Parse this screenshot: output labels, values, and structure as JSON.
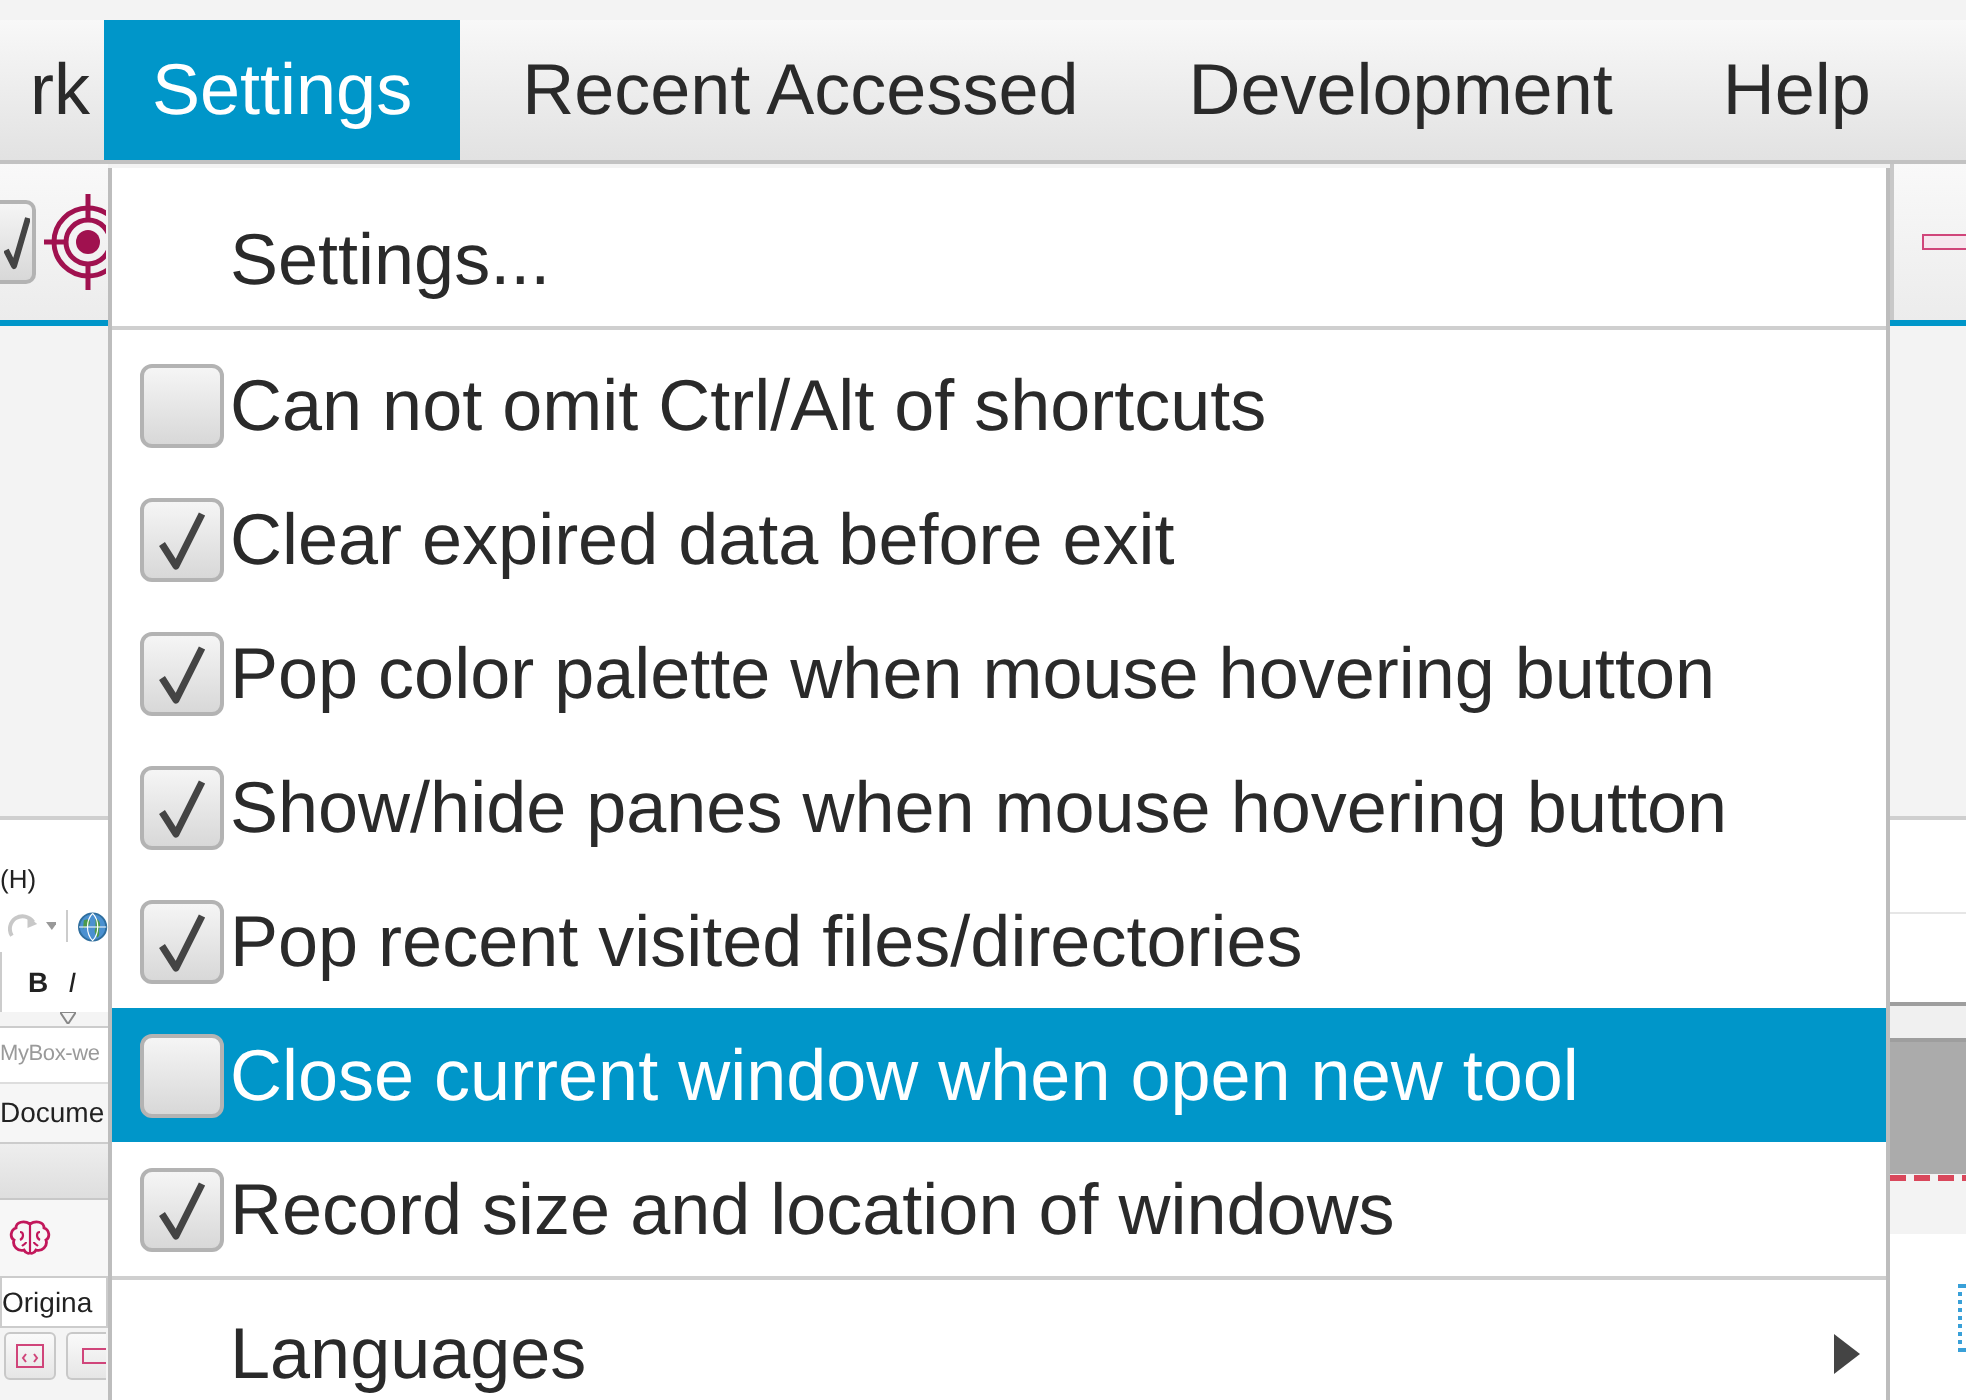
{
  "menu_bar": {
    "items": [
      {
        "label": "rk",
        "selected": false
      },
      {
        "label": "Settings",
        "selected": true
      },
      {
        "label": "Recent Accessed",
        "selected": false
      },
      {
        "label": "Development",
        "selected": false
      },
      {
        "label": "Help",
        "selected": false
      }
    ]
  },
  "settings_menu": {
    "items": [
      {
        "kind": "action",
        "label": "Settings...",
        "highlighted": false
      },
      {
        "kind": "separator"
      },
      {
        "kind": "check",
        "label": "Can not omit Ctrl/Alt of shortcuts",
        "checked": false,
        "highlighted": false
      },
      {
        "kind": "check",
        "label": "Clear expired data before exit",
        "checked": true,
        "highlighted": false
      },
      {
        "kind": "check",
        "label": "Pop color palette when mouse hovering button",
        "checked": true,
        "highlighted": false
      },
      {
        "kind": "check",
        "label": "Show/hide panes when mouse hovering button",
        "checked": true,
        "highlighted": false
      },
      {
        "kind": "check",
        "label": "Pop recent visited files/directories",
        "checked": true,
        "highlighted": false
      },
      {
        "kind": "check",
        "label": "Close current window when open new tool",
        "checked": false,
        "highlighted": true
      },
      {
        "kind": "check",
        "label": "Record size and location of windows",
        "checked": true,
        "highlighted": false
      },
      {
        "kind": "separator"
      },
      {
        "kind": "submenu",
        "label": "Languages",
        "highlighted": false
      }
    ]
  },
  "background_window": {
    "menu_label": "(H)",
    "bold_button": "B",
    "italic_button": "I",
    "address_field": "MyBox-we",
    "document_tab": "Docume",
    "original_field": "Origina"
  }
}
